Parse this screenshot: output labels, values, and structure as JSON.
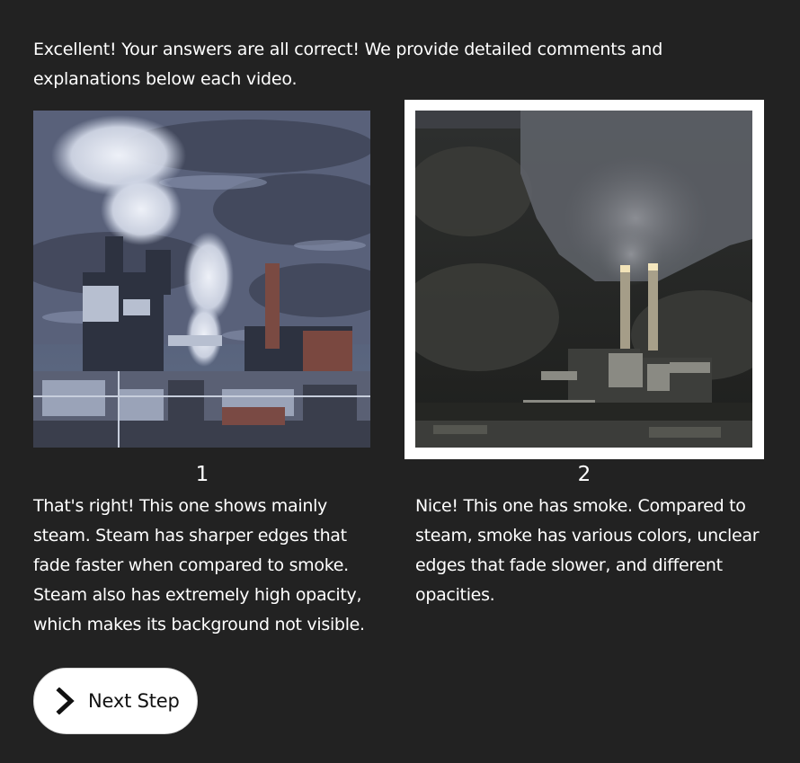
{
  "intro": {
    "text": "Excellent! Your answers are all correct! We provide detailed comments and explanations below each video."
  },
  "videos": [
    {
      "number": "1",
      "selected": false,
      "explanation": "That's right! This one shows mainly steam. Steam has sharper edges that fade faster when compared to smoke. Steam also has extremely high opacity, which makes its background not visible."
    },
    {
      "number": "2",
      "selected": true,
      "explanation": "Nice! This one has smoke. Compared to steam, smoke has various colors, unclear edges that fade slower, and different opacities."
    }
  ],
  "next_button": {
    "label": "Next Step",
    "icon": "chevron-right-icon"
  },
  "colors": {
    "background": "#222222",
    "text": "#ffffff",
    "selected_frame": "#ffffff",
    "button_bg": "#ffffff",
    "button_text": "#111111"
  }
}
